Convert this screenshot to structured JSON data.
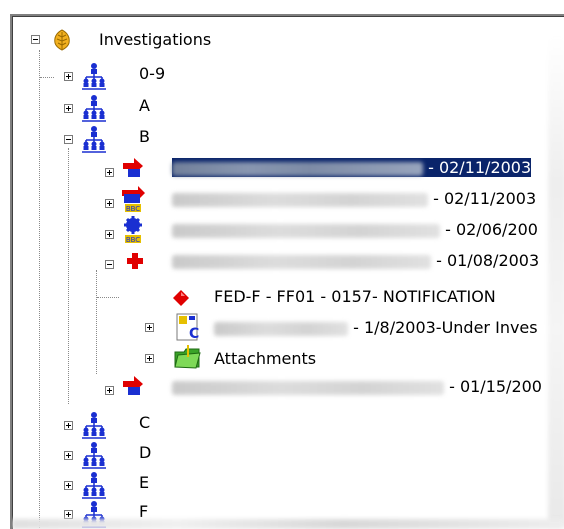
{
  "tree": {
    "root": {
      "label": "Investigations",
      "icon": "leaf-icon"
    },
    "groups": [
      {
        "label": "0-9",
        "icon": "org-chart-icon"
      },
      {
        "label": "A",
        "icon": "org-chart-icon"
      },
      {
        "label": "B",
        "icon": "org-chart-icon"
      },
      {
        "label": "C",
        "icon": "org-chart-icon"
      },
      {
        "label": "D",
        "icon": "org-chart-icon"
      },
      {
        "label": "E",
        "icon": "org-chart-icon"
      },
      {
        "label": "F",
        "icon": "org-chart-icon"
      }
    ],
    "b_children": [
      {
        "suffix": " - 02/11/2003",
        "icon": "red-blue-arrows-icon",
        "selected": true
      },
      {
        "suffix": " - 02/11/2003",
        "icon": "blue-truck-badge-icon",
        "selected": false
      },
      {
        "suffix": " - 02/06/200",
        "icon": "gear-badge-icon",
        "selected": false
      },
      {
        "suffix": " - 01/08/2003",
        "icon": "red-cross-icon",
        "selected": false
      },
      {
        "suffix": " - 01/15/200",
        "icon": "red-blue-arrows-icon",
        "selected": false
      }
    ],
    "cross_children": [
      {
        "label": "FED-F - FF01 - 0157- NOTIFICATION",
        "icon": "red-diamond-icon"
      },
      {
        "label": " - 1/8/2003-Under Inves",
        "icon": "document-c-icon"
      },
      {
        "label": "Attachments",
        "icon": "folder-paperclip-icon"
      }
    ]
  },
  "colors": {
    "selection": "#0a246a",
    "red": "#e00000",
    "blue": "#1a2fd1"
  }
}
